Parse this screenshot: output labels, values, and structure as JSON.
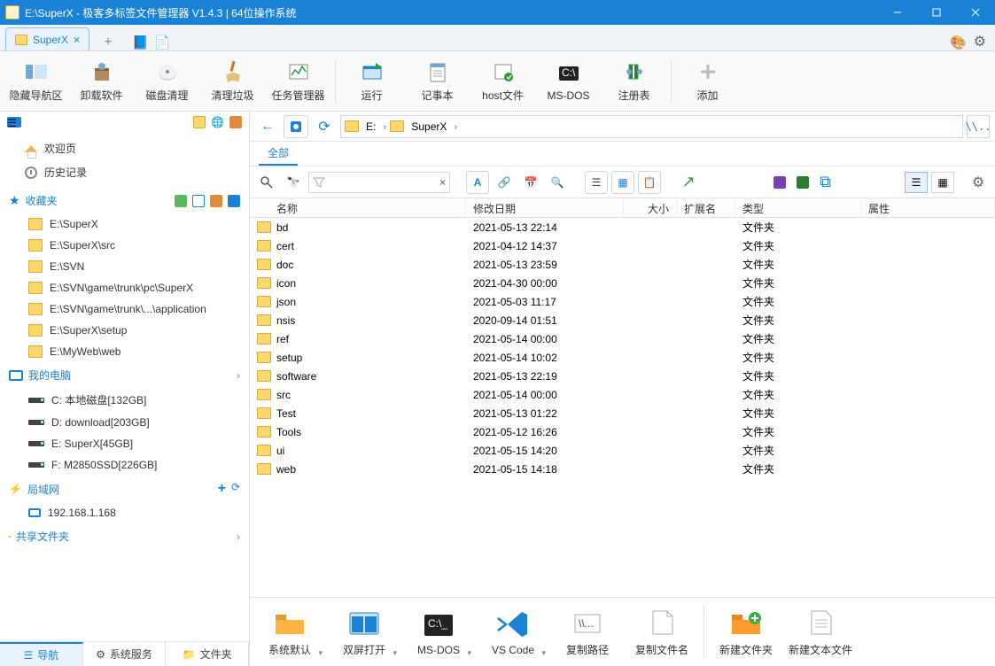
{
  "title": "E:\\SuperX - 极客多标签文件管理器 V1.4.3  |  64位操作系统",
  "tab_label": "SuperX",
  "toolbar": [
    {
      "label": "隐藏导航区",
      "icon": "nav"
    },
    {
      "label": "卸载软件",
      "icon": "uninstall"
    },
    {
      "label": "磁盘清理",
      "icon": "disk"
    },
    {
      "label": "清理垃圾",
      "icon": "brush"
    },
    {
      "label": "任务管理器",
      "icon": "task"
    },
    {
      "label": "运行",
      "icon": "run"
    },
    {
      "label": "记事本",
      "icon": "notepad"
    },
    {
      "label": "host文件",
      "icon": "host"
    },
    {
      "label": "MS-DOS",
      "icon": "dos"
    },
    {
      "label": "注册表",
      "icon": "reg"
    },
    {
      "label": "添加",
      "icon": "add"
    }
  ],
  "sep_after": [
    4,
    9
  ],
  "side": {
    "welcome": "欢迎页",
    "history": "历史记录",
    "fav_title": "收藏夹",
    "favs": [
      "E:\\SuperX",
      "E:\\SuperX\\src",
      "E:\\SVN",
      "E:\\SVN\\game\\trunk\\pc\\SuperX",
      "E:\\SVN\\game\\trunk\\...\\application",
      "E:\\SuperX\\setup",
      "E:\\MyWeb\\web"
    ],
    "pc_title": "我的电脑",
    "drives": [
      "C: 本地磁盘[132GB]",
      "D: download[203GB]",
      "E: SuperX[45GB]",
      "F: M2850SSD[226GB]"
    ],
    "lan_title": "局域网",
    "lan_items": [
      "192.168.1.168"
    ],
    "share_title": "共享文件夹"
  },
  "breadcrumb": [
    "E:",
    "SuperX"
  ],
  "filter_tab": "全部",
  "columns": {
    "name": "名称",
    "date": "修改日期",
    "size": "大小",
    "ext": "扩展名",
    "type": "类型",
    "attr": "属性"
  },
  "type_folder": "文件夹",
  "files": [
    {
      "name": "bd",
      "date": "2021-05-13 22:14"
    },
    {
      "name": "cert",
      "date": "2021-04-12 14:37"
    },
    {
      "name": "doc",
      "date": "2021-05-13 23:59"
    },
    {
      "name": "icon",
      "date": "2021-04-30 00:00"
    },
    {
      "name": "json",
      "date": "2021-05-03 11:17"
    },
    {
      "name": "nsis",
      "date": "2020-09-14 01:51"
    },
    {
      "name": "ref",
      "date": "2021-05-14 00:00"
    },
    {
      "name": "setup",
      "date": "2021-05-14 10:02"
    },
    {
      "name": "software",
      "date": "2021-05-13 22:19"
    },
    {
      "name": "src",
      "date": "2021-05-14 00:00"
    },
    {
      "name": "Test",
      "date": "2021-05-13 01:22"
    },
    {
      "name": "Tools",
      "date": "2021-05-12 16:26"
    },
    {
      "name": "ui",
      "date": "2021-05-15 14:20"
    },
    {
      "name": "web",
      "date": "2021-05-15 14:18"
    }
  ],
  "bottom": [
    {
      "label": "系统默认",
      "icon": "folder"
    },
    {
      "label": "双屏打开",
      "icon": "split"
    },
    {
      "label": "MS-DOS",
      "icon": "dos"
    },
    {
      "label": "VS Code",
      "icon": "vscode"
    },
    {
      "label": "复制路径",
      "icon": "path"
    },
    {
      "label": "复制文件名",
      "icon": "file"
    },
    {
      "label": "新建文件夹",
      "icon": "newfolder"
    },
    {
      "label": "新建文本文件",
      "icon": "newtxt"
    }
  ],
  "sidetabs": [
    {
      "label": "导航",
      "active": true
    },
    {
      "label": "系统服务",
      "active": false
    },
    {
      "label": "文件夹",
      "active": false
    }
  ]
}
